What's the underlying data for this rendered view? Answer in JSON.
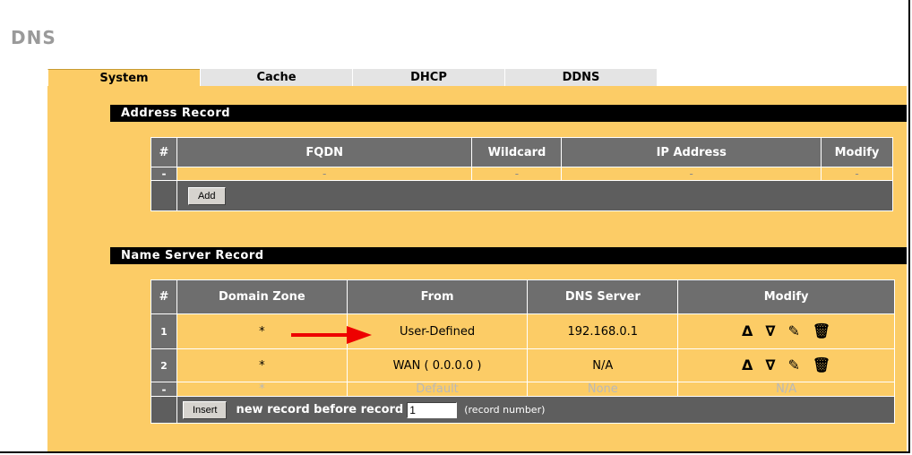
{
  "page": {
    "title": "DNS"
  },
  "tabs": [
    {
      "label": "System",
      "active": true
    },
    {
      "label": "Cache",
      "active": false
    },
    {
      "label": "DHCP",
      "active": false
    },
    {
      "label": "DDNS",
      "active": false
    }
  ],
  "address_record": {
    "title": "Address Record",
    "columns": [
      "#",
      "FQDN",
      "Wildcard",
      "IP Address",
      "Modify"
    ],
    "rows": [
      {
        "idx": "-",
        "fqdn": "-",
        "wildcard": "-",
        "ip": "-",
        "modify": "-"
      }
    ],
    "add_label": "Add"
  },
  "name_server_record": {
    "title": "Name Server Record",
    "columns": [
      "#",
      "Domain Zone",
      "From",
      "DNS Server",
      "Modify"
    ],
    "rows": [
      {
        "idx": "1",
        "zone": "*",
        "from": "User-Defined",
        "server": "192.168.0.1",
        "modify": "icons"
      },
      {
        "idx": "2",
        "zone": "*",
        "from": "WAN ( 0.0.0.0 )",
        "server": "N/A",
        "modify": "icons"
      },
      {
        "idx": "-",
        "zone": "*",
        "from": "Default",
        "server": "None",
        "modify": "N/A"
      }
    ],
    "insert_label": "Insert",
    "insert_text": "new record before record",
    "record_number_value": "1",
    "record_number_hint": "(record number)"
  },
  "modify_icons": [
    "move-up-icon",
    "move-down-icon",
    "edit-icon",
    "delete-icon"
  ],
  "colors": {
    "panel": "#fccc66",
    "header": "#6e6e6e",
    "bar": "#000000",
    "arrow": "#ee0000"
  }
}
